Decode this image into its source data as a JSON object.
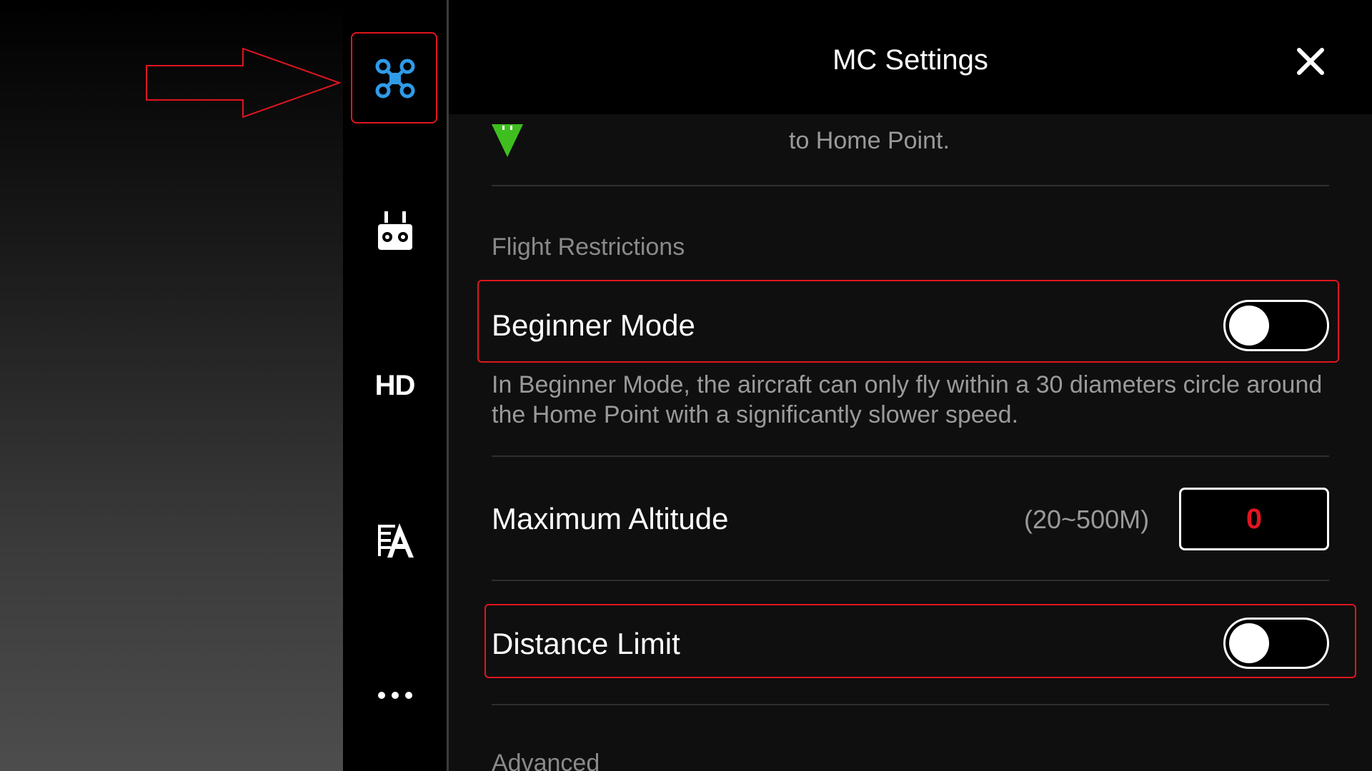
{
  "colors": {
    "accent_blue": "#2f9be8",
    "highlight_red": "#e0151f",
    "home_marker_green": "#3fbf1f",
    "value_red": "#e0151f"
  },
  "sidebar": {
    "items": [
      {
        "id": "mc",
        "icon": "aircraft-icon",
        "active": true
      },
      {
        "id": "rc",
        "icon": "remote-controller-icon"
      },
      {
        "id": "hd",
        "label": "HD"
      },
      {
        "id": "battery",
        "icon": "battery-icon"
      },
      {
        "id": "more",
        "icon": "more-icon"
      }
    ]
  },
  "header": {
    "title": "MC Settings",
    "close_icon": "close-icon"
  },
  "home_point": {
    "text": "to Home Point."
  },
  "flight_restrictions": {
    "section_title": "Flight Restrictions",
    "beginner_mode": {
      "label": "Beginner Mode",
      "enabled": false,
      "description": "In Beginner Mode, the aircraft can only fly within a 30 diameters circle around the Home Point with a significantly slower speed."
    },
    "max_altitude": {
      "label": "Maximum Altitude",
      "range": "(20~500M)",
      "value": "0"
    },
    "distance_limit": {
      "label": "Distance Limit",
      "enabled": false
    }
  },
  "advanced": {
    "section_title": "Advanced"
  }
}
